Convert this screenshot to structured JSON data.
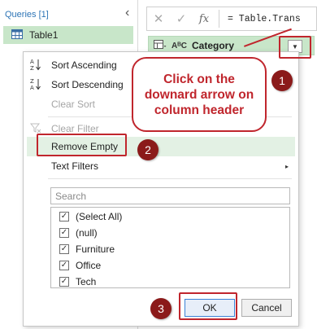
{
  "queries_pane": {
    "header": "Queries [1]",
    "collapse_glyph": "‹",
    "items": [
      {
        "label": "Table1",
        "icon": "table-icon"
      }
    ]
  },
  "formula_bar": {
    "cancel_glyph": "✕",
    "confirm_glyph": "✓",
    "fx_glyph": "fx",
    "formula": "= Table.Trans"
  },
  "column_header": {
    "type_label": "AᴮC",
    "name": "Category",
    "dropdown_glyph": "▼"
  },
  "menu": {
    "items": [
      {
        "label": "Sort Ascending",
        "icon_glyph": "A↓Z",
        "enabled": true
      },
      {
        "label": "Sort Descending",
        "icon_glyph": "Z↓A",
        "enabled": true
      },
      {
        "label": "Clear Sort",
        "icon_glyph": "",
        "enabled": false
      },
      {
        "label": "Clear Filter",
        "icon_glyph": "⊽",
        "enabled": false
      },
      {
        "label": "Remove Empty",
        "icon_glyph": "",
        "enabled": true
      },
      {
        "label": "Text Filters",
        "icon_glyph": "",
        "enabled": true,
        "submenu_glyph": "▸"
      }
    ],
    "search_placeholder": "Search",
    "values": [
      {
        "label": "(Select All)",
        "checked": true
      },
      {
        "label": "(null)",
        "checked": true
      },
      {
        "label": "Furniture",
        "checked": true
      },
      {
        "label": "Office",
        "checked": true
      },
      {
        "label": "Tech",
        "checked": true
      }
    ],
    "check_glyph": "✓",
    "ok_label": "OK",
    "cancel_label": "Cancel"
  },
  "annotations": {
    "callout_text": "Click on the downard arrow on column header",
    "steps": [
      "1",
      "2",
      "3"
    ],
    "accent_color": "#c0262d",
    "step_color": "#8b1a1a"
  }
}
